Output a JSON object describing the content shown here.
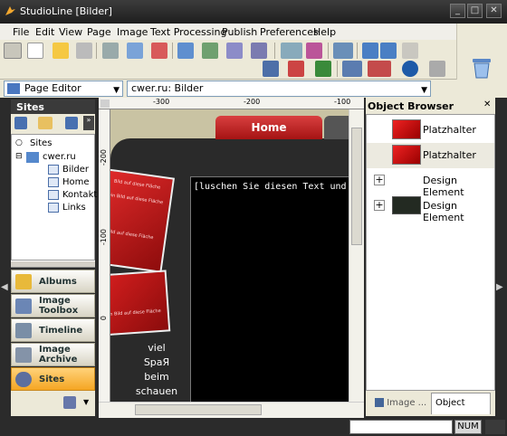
{
  "window": {
    "title": "StudioLine [Bilder]",
    "min": "_",
    "max": "□",
    "close": "✕"
  },
  "menu": [
    "File",
    "Edit",
    "View",
    "Page",
    "Image",
    "Text Processing",
    "Publish",
    "Preferences",
    "Help"
  ],
  "address": {
    "view_mode": "Page Editor",
    "page_path": "cwer.ru: Bilder"
  },
  "sites_panel": {
    "title": "Sites",
    "tree": [
      {
        "label": "Sites"
      },
      {
        "label": "cwer.ru"
      },
      {
        "label": "Bilder"
      },
      {
        "label": "Home"
      },
      {
        "label": "Kontakt"
      },
      {
        "label": "Links"
      }
    ]
  },
  "nav": [
    {
      "label": "Albums",
      "icon": "folder-icon"
    },
    {
      "label": "Image Toolbox",
      "icon": "image-toolbox-icon"
    },
    {
      "label": "Timeline",
      "icon": "timeline-icon"
    },
    {
      "label": "Image Archive",
      "icon": "image-archive-icon"
    },
    {
      "label": "Sites",
      "icon": "sites-icon"
    }
  ],
  "ruler": {
    "marks": [
      "-300",
      "-200",
      "-100"
    ],
    "vmarks": [
      "-200",
      "-100",
      "0"
    ]
  },
  "canvas": {
    "tab_label": "Home",
    "text_box": "[luschen Sie diesen Text und dro",
    "side_text": [
      "viel",
      "SpaЯ",
      "beim",
      "schauen"
    ],
    "photo_texts": [
      "Bild auf diese Fläche",
      "ein Bild auf diese Fläche",
      "Bild auf diese Fläche",
      "ein Bild auf diese Fläche"
    ]
  },
  "object_browser": {
    "title": "Object Browser",
    "items": [
      {
        "label": "Platzhalter",
        "expander": ""
      },
      {
        "label": "Platzhalter",
        "expander": ""
      },
      {
        "label": "Design Element",
        "expander": "+"
      },
      {
        "label": "Design Element",
        "expander": "+"
      }
    ],
    "tabs": [
      "Image ...",
      "Object Bro..."
    ]
  },
  "status": {
    "num": "NUM"
  },
  "colors": {
    "accent_red": "#c01818",
    "dark_bg": "#2b2b2b",
    "active_nav": "#f7b731"
  }
}
